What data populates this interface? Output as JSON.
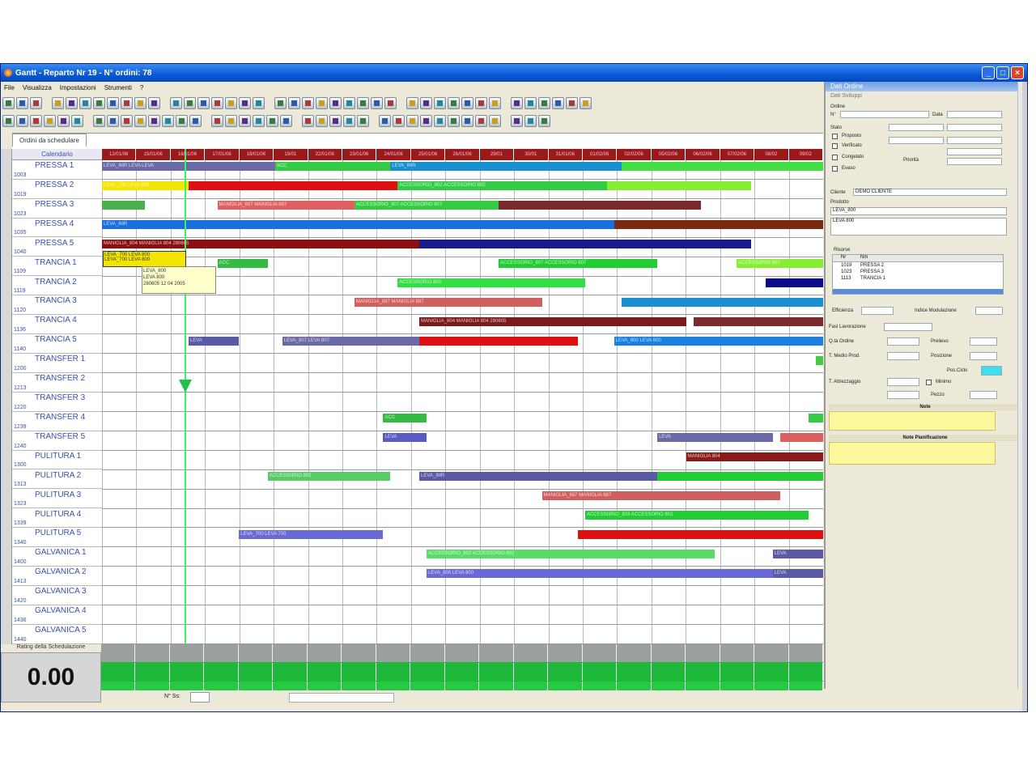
{
  "window": {
    "title": "Gantt - Reparto Nr 19 - N° ordini: 78",
    "buttons": [
      "_",
      "□",
      "×"
    ]
  },
  "menu": [
    "File",
    "Visualizza",
    "Impostazioni",
    "Strumenti",
    "?"
  ],
  "tab": "Ordini da schedulare",
  "calendar_header": "Calendario",
  "dates": [
    "12/01/06",
    "15/01/06",
    "16/01/06",
    "17/01/06",
    "18/01/06",
    "19/01",
    "22/01/06",
    "23/01/06",
    "24/01/06",
    "25/01/06",
    "26/01/06",
    "29/01",
    "30/01",
    "31/01/06",
    "01/02/06",
    "02/02/06",
    "05/02/06",
    "06/02/06",
    "07/02/06",
    "08/02",
    "09/02"
  ],
  "resources": [
    {
      "code": "1003",
      "name": "PRESSA 1"
    },
    {
      "code": "1019",
      "name": "PRESSA 2"
    },
    {
      "code": "1023",
      "name": "PRESSA 3"
    },
    {
      "code": "1035",
      "name": "PRESSA 4"
    },
    {
      "code": "1040",
      "name": "PRESSA 5"
    },
    {
      "code": "1109",
      "name": "TRANCIA 1"
    },
    {
      "code": "1119",
      "name": "TRANCIA 2"
    },
    {
      "code": "1120",
      "name": "TRANCIA 3"
    },
    {
      "code": "1136",
      "name": "TRANCIA 4"
    },
    {
      "code": "1140",
      "name": "TRANCIA 5"
    },
    {
      "code": "1200",
      "name": "TRANSFER 1"
    },
    {
      "code": "1213",
      "name": "TRANSFER 2"
    },
    {
      "code": "1220",
      "name": "TRANSFER 3"
    },
    {
      "code": "1239",
      "name": "TRANSFER 4"
    },
    {
      "code": "1240",
      "name": "TRANSFER 5"
    },
    {
      "code": "1300",
      "name": "PULITURA 1"
    },
    {
      "code": "1313",
      "name": "PULITURA 2"
    },
    {
      "code": "1323",
      "name": "PULITURA 3"
    },
    {
      "code": "1339",
      "name": "PULITURA 4"
    },
    {
      "code": "1340",
      "name": "PULITURA 5"
    },
    {
      "code": "1400",
      "name": "GALVANICA 1"
    },
    {
      "code": "1413",
      "name": "GALVANICA 2"
    },
    {
      "code": "1420",
      "name": "GALVANICA 3"
    },
    {
      "code": "1436",
      "name": "GALVANICA 4"
    },
    {
      "code": "1440",
      "name": "GALVANICA 5"
    }
  ],
  "bars": [
    {
      "row": 0,
      "start": 0,
      "end": 0.24,
      "color": "#6a6aa6",
      "label": "LEVA_IMR LEVA LEVA"
    },
    {
      "row": 0,
      "start": 0.24,
      "end": 0.4,
      "color": "#33cc44",
      "label": "ACC"
    },
    {
      "row": 0,
      "start": 0.4,
      "end": 0.72,
      "color": "#1a8fcf",
      "label": "LEVA_IMR"
    },
    {
      "row": 0,
      "start": 0.72,
      "end": 1,
      "color": "#44dd44",
      "label": ""
    },
    {
      "row": 1,
      "start": 0,
      "end": 0.12,
      "color": "#f2e600",
      "label": "LEVA_700 LEVA 800"
    },
    {
      "row": 1,
      "start": 0.12,
      "end": 0.41,
      "color": "#dd1111",
      "label": ""
    },
    {
      "row": 1,
      "start": 0.41,
      "end": 0.7,
      "color": "#33cc44",
      "label": "ACCESSORIO_802 ACCESSORIO 802"
    },
    {
      "row": 1,
      "start": 0.7,
      "end": 0.9,
      "color": "#88ee33",
      "label": ""
    },
    {
      "row": 2,
      "start": 0,
      "end": 0.06,
      "color": "#4caf50",
      "label": ""
    },
    {
      "row": 2,
      "start": 0.16,
      "end": 0.35,
      "color": "#e06060",
      "label": "MANIGLIA_887 MANIGLIA 887"
    },
    {
      "row": 2,
      "start": 0.35,
      "end": 0.55,
      "color": "#33cc44",
      "label": "ACCESSORIO_807 ACCESSORIO 807"
    },
    {
      "row": 2,
      "start": 0.55,
      "end": 0.83,
      "color": "#7a2a2a",
      "label": ""
    },
    {
      "row": 3,
      "start": 0,
      "end": 0.71,
      "color": "#1a6fdf",
      "label": "LEVA_IMR"
    },
    {
      "row": 3,
      "start": 0.71,
      "end": 1,
      "color": "#7a2a10",
      "label": ""
    },
    {
      "row": 4,
      "start": 0,
      "end": 0.44,
      "color": "#8a1010",
      "label": "MANIGLIA_804 MANIGLIA 804 280605"
    },
    {
      "row": 4,
      "start": 0.44,
      "end": 0.9,
      "color": "#1a1a8a",
      "label": ""
    },
    {
      "row": 5,
      "start": 0.16,
      "end": 0.23,
      "color": "#33bb44",
      "label": "ACC"
    },
    {
      "row": 5,
      "start": 0.55,
      "end": 0.77,
      "color": "#22cc33",
      "label": "ACCESSORIO_807 ACCESSORIO 807"
    },
    {
      "row": 5,
      "start": 0.88,
      "end": 1,
      "color": "#88ee33",
      "label": "ACCESSORIO 807"
    },
    {
      "row": 6,
      "start": 0.41,
      "end": 0.67,
      "color": "#33dd44",
      "label": "ACCESSORIO 803"
    },
    {
      "row": 6,
      "start": 0.92,
      "end": 1,
      "color": "#0a0a8a",
      "label": ""
    },
    {
      "row": 7,
      "start": 0.35,
      "end": 0.61,
      "color": "#d06060",
      "label": "MANIGLIA_887 MANIGLIA 887"
    },
    {
      "row": 7,
      "start": 0.72,
      "end": 1,
      "color": "#1a8fcf",
      "label": ""
    },
    {
      "row": 8,
      "start": 0.44,
      "end": 0.81,
      "color": "#7a1a1a",
      "label": "MANIGLIA_804 MANIGLIA 804 280605"
    },
    {
      "row": 8,
      "start": 0.82,
      "end": 1,
      "color": "#7a2a2a",
      "label": ""
    },
    {
      "row": 9,
      "start": 0.12,
      "end": 0.19,
      "color": "#5a5aa6",
      "label": "LEVA"
    },
    {
      "row": 9,
      "start": 0.25,
      "end": 0.44,
      "color": "#6a6aa6",
      "label": "LEVA_807 LEVA 807"
    },
    {
      "row": 9,
      "start": 0.44,
      "end": 0.66,
      "color": "#dd1111",
      "label": ""
    },
    {
      "row": 9,
      "start": 0.71,
      "end": 1,
      "color": "#1a7fdf",
      "label": "LEVA_800 LEVA 800"
    },
    {
      "row": 10,
      "start": 0.99,
      "end": 1,
      "color": "#44cc44",
      "label": ""
    },
    {
      "row": 13,
      "start": 0.39,
      "end": 0.45,
      "color": "#33bb44",
      "label": "ACC"
    },
    {
      "row": 13,
      "start": 0.98,
      "end": 1,
      "color": "#33cc44",
      "label": ""
    },
    {
      "row": 14,
      "start": 0.39,
      "end": 0.45,
      "color": "#5a5ac6",
      "label": "LEVA"
    },
    {
      "row": 14,
      "start": 0.77,
      "end": 0.93,
      "color": "#6a6aa6",
      "label": "LEVA"
    },
    {
      "row": 14,
      "start": 0.94,
      "end": 1,
      "color": "#dd6060",
      "label": ""
    },
    {
      "row": 15,
      "start": 0.81,
      "end": 1,
      "color": "#8a1a1a",
      "label": "MANIGLIA 804"
    },
    {
      "row": 16,
      "start": 0.23,
      "end": 0.4,
      "color": "#55cc66",
      "label": "ACCESSORIO 802"
    },
    {
      "row": 16,
      "start": 0.44,
      "end": 0.77,
      "color": "#5a5aa6",
      "label": "LEVA_IMR"
    },
    {
      "row": 16,
      "start": 0.77,
      "end": 1,
      "color": "#22cc33",
      "label": ""
    },
    {
      "row": 17,
      "start": 0.61,
      "end": 0.94,
      "color": "#d06060",
      "label": "MANIGLIA_887 MANIGLIA 887"
    },
    {
      "row": 18,
      "start": 0.67,
      "end": 0.98,
      "color": "#22cc33",
      "label": "ACCESSORIO_803 ACCESSORIO 803"
    },
    {
      "row": 19,
      "start": 0.19,
      "end": 0.39,
      "color": "#6a6ad6",
      "label": "LEVA_700 LEVA 700"
    },
    {
      "row": 19,
      "start": 0.66,
      "end": 1,
      "color": "#dd1111",
      "label": ""
    },
    {
      "row": 20,
      "start": 0.45,
      "end": 0.85,
      "color": "#55dd66",
      "label": "ACCESSORIO_802 ACCESSORIO 802"
    },
    {
      "row": 20,
      "start": 0.93,
      "end": 1,
      "color": "#5a5aa6",
      "label": "LEVA"
    },
    {
      "row": 21,
      "start": 0.45,
      "end": 0.93,
      "color": "#6a6ad6",
      "label": "LEVA_800 LEVA 800"
    },
    {
      "row": 21,
      "start": 0.93,
      "end": 1,
      "color": "#5a5aa6",
      "label": "LEVA"
    }
  ],
  "tooltip": {
    "yellow_line1": "LEVA_700 LEVA 800",
    "yellow_line2": "LEVA_700 LEVA 800",
    "box_lines": [
      "LEVA_800",
      "LEVA 800",
      "280605 12 04 2005"
    ]
  },
  "rating": {
    "label": "Rating della Schedulazione",
    "value": "0.00"
  },
  "bottom_bar": {
    "label": "N° Ss:"
  },
  "panel": {
    "title": "Dati Ordine",
    "tabs": "Dati   Sviluppi",
    "section_ordine": "Ordine",
    "ordine_nr_label": "N°",
    "data_label": "Data",
    "stato_label": "Stato",
    "proposto_label": "Proposto",
    "verificato_label": "Verificato",
    "congelato_label": "Congelato",
    "evaso_label": "Evaso",
    "priorita_label": "Priorità",
    "cliente_label": "Cliente",
    "cliente_value": "DEMO CLIENTE",
    "prodotto_label": "Prodotto",
    "prodotto_value1": "LEVA_800",
    "prodotto_value2": "LEVA 800",
    "risorse_label": "Risorse",
    "risorse_cols": [
      "Nr",
      "Nm"
    ],
    "risorse_rows": [
      [
        "1019",
        "PRESSA 2"
      ],
      [
        "1023",
        "PRESSA 3"
      ],
      [
        "1113",
        "TRANCIA 1"
      ]
    ],
    "efficienza_label": "Efficienza",
    "indice_label": "Indice Modulazione",
    "fasi_label": "Fasi Lavorazione",
    "qta_label": "Q.tà Ordine",
    "tempo_label": "T. Medio Prod.",
    "prelievo_label": "Prelievo",
    "posizione_label": "Posizione",
    "pos_ciclo_label": "Pos.Ciclo",
    "attrezzaggio_label": "T. Attrezzaggio",
    "minimo_label": "Minimo",
    "pezzo_label": "Pezzo",
    "note_label": "Note",
    "note_pianificazione_label": "Note Pianificazione"
  }
}
